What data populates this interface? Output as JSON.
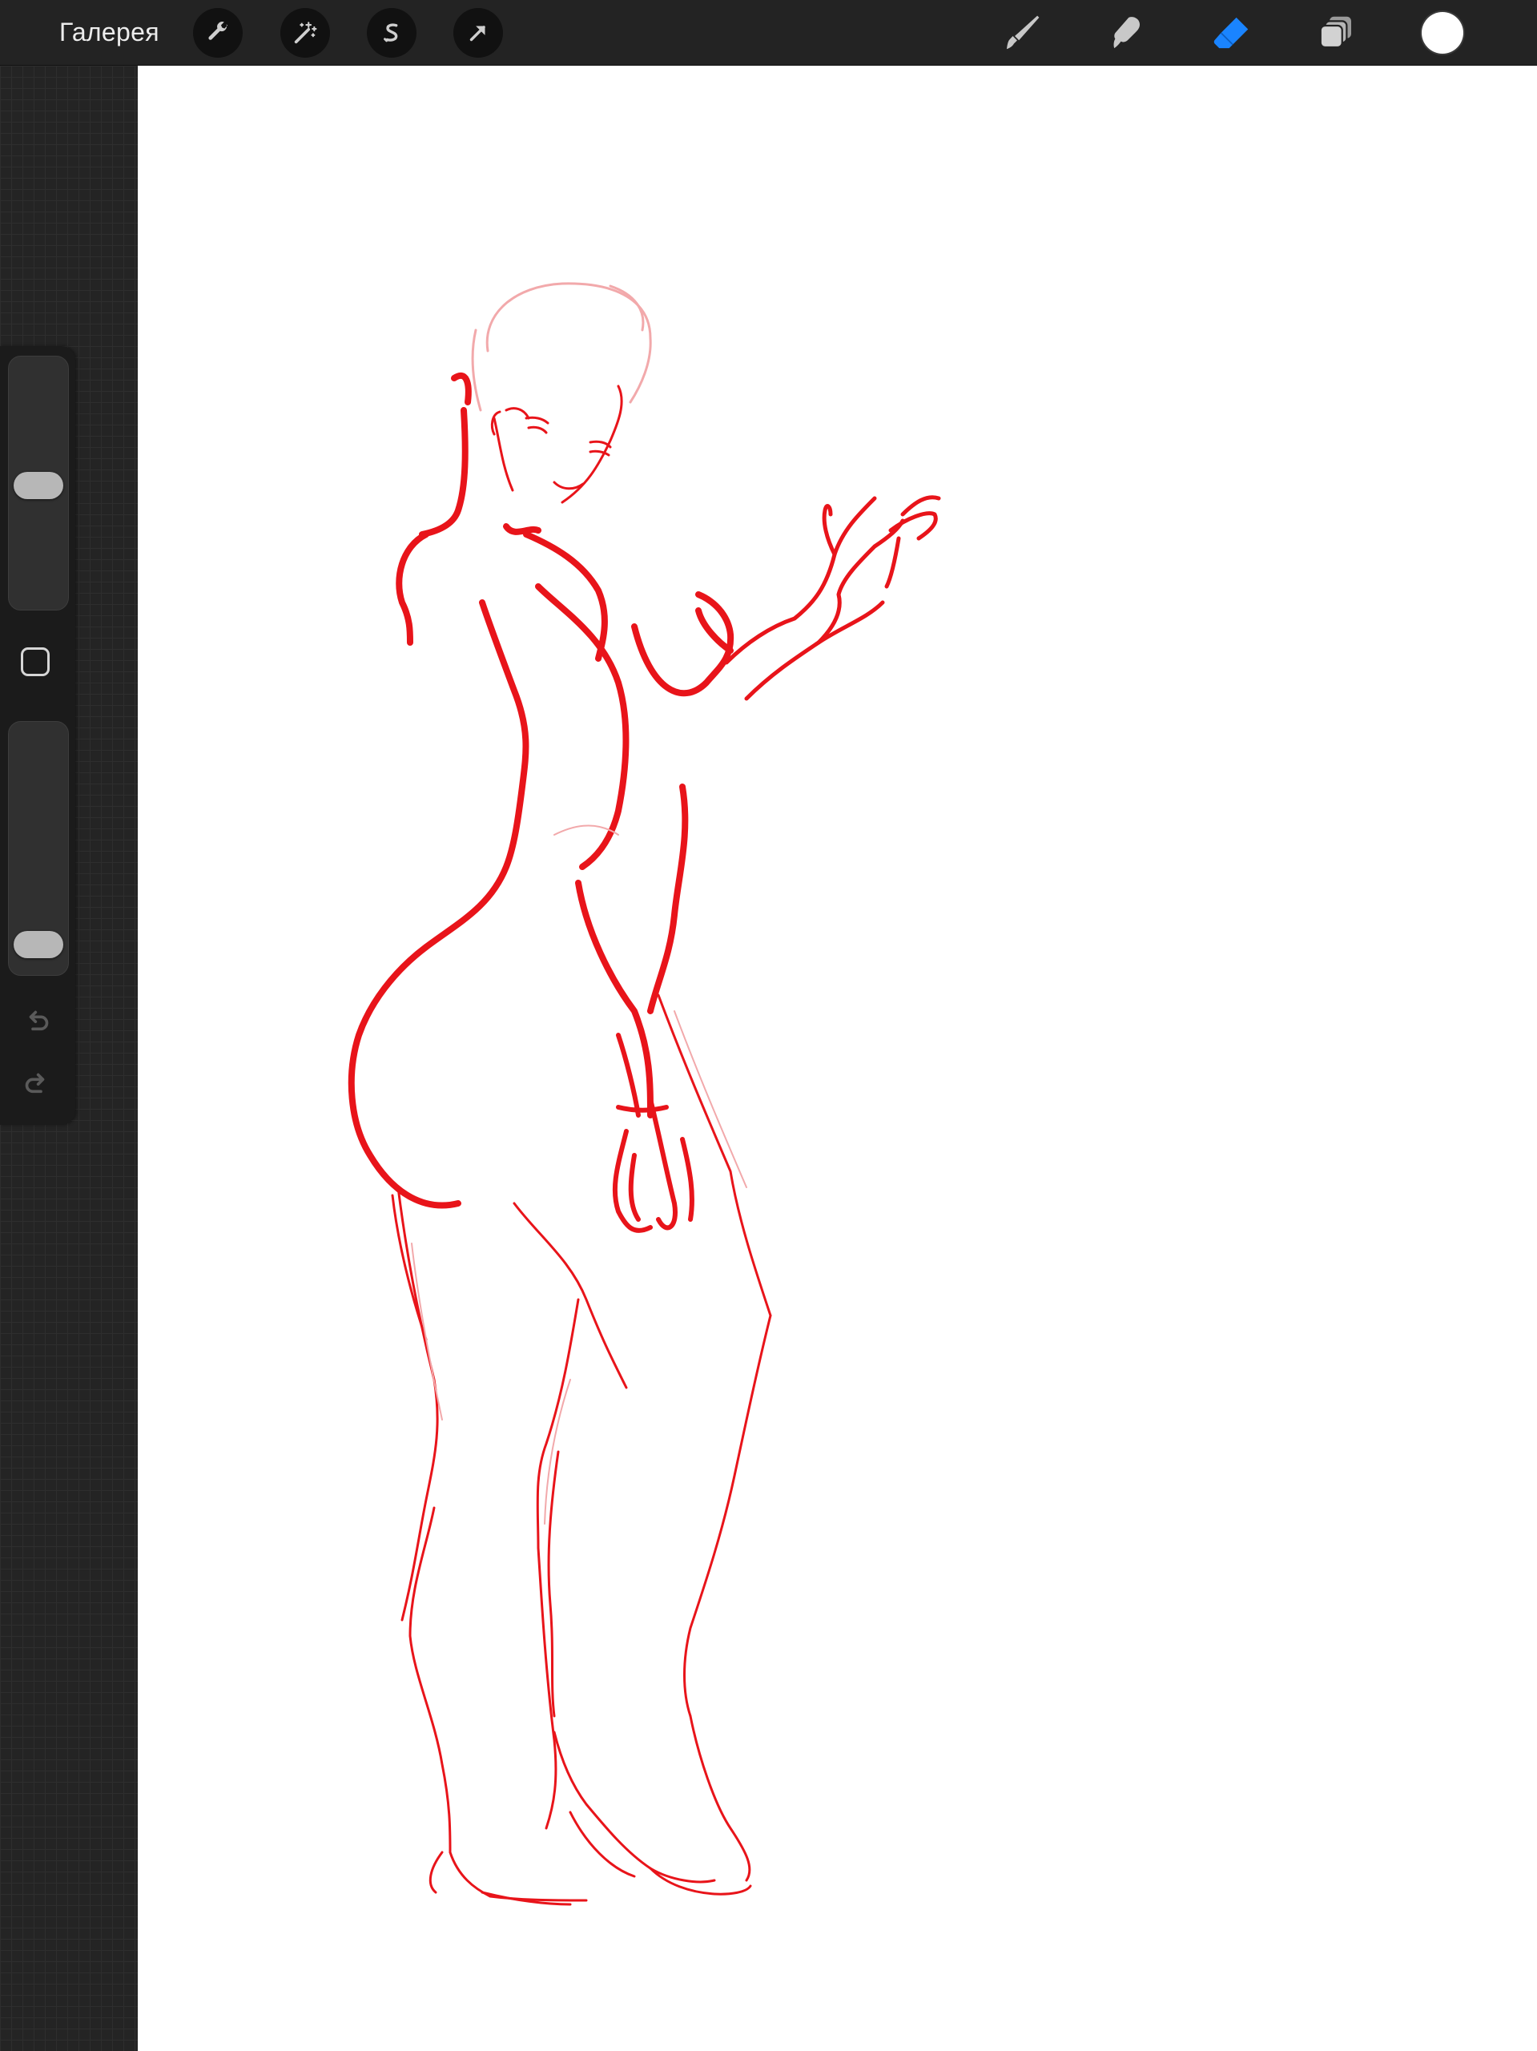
{
  "topbar": {
    "gallery_label": "Галерея",
    "left_tools": [
      {
        "name": "actions",
        "icon": "wrench-icon"
      },
      {
        "name": "adjustments",
        "icon": "magic-wand-icon"
      },
      {
        "name": "selection",
        "icon": "selection-s-icon"
      },
      {
        "name": "transform",
        "icon": "arrow-cursor-icon"
      }
    ],
    "right_tools": [
      {
        "name": "brush",
        "icon": "brush-icon",
        "active": false
      },
      {
        "name": "smudge",
        "icon": "smudge-icon",
        "active": false
      },
      {
        "name": "eraser",
        "icon": "eraser-icon",
        "active": true
      },
      {
        "name": "layers",
        "icon": "layers-icon",
        "active": false
      }
    ],
    "current_color": "#ffffff"
  },
  "sidebar": {
    "brush_size_level": 0.49,
    "opacity_level": 0.06,
    "modify_button_icon": "square-icon",
    "undo_icon": "undo-icon",
    "redo_icon": "redo-icon"
  },
  "canvas": {
    "background": "#ffffff",
    "sketch_color": "#e8141a",
    "sketch_light_color": "#f2a9ab"
  },
  "colors": {
    "toolbar_bg": "#232323",
    "accent_active": "#1a84ff",
    "icon_gray": "#c8c8c8"
  }
}
